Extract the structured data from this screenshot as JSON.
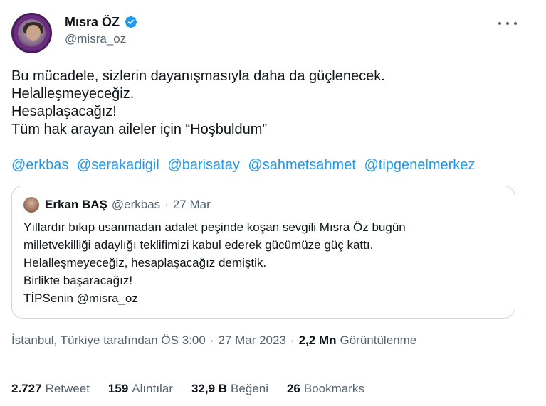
{
  "author": {
    "display_name": "Mısra ÖZ",
    "handle": "@misra_oz",
    "verified": true,
    "verified_color": "#1d9bf0"
  },
  "tweet": {
    "lines": [
      "Bu mücadele, sizlerin dayanışmasıyla daha da güçlenecek.",
      "Helalleşmeyeceğiz.",
      "Hesaplaşacağız!",
      "Tüm hak arayan aileler için “Hoşbuldum”"
    ],
    "mentions": [
      "@erkbas",
      "@serakadigil",
      "@barisatay",
      "@sahmetsahmet",
      "@tipgenelmerkez"
    ]
  },
  "quote": {
    "display_name": "Erkan BAŞ",
    "handle": "@erkbas",
    "separator": "·",
    "date": "27 Mar",
    "lines": [
      "Yıllardır bıkıp usanmadan adalet peşinde koşan sevgili Mısra Öz bugün",
      "milletvekilliği adaylığı teklifimizi kabul ederek gücümüze güç kattı.",
      "Helalleşmeyeceğiz, hesaplaşacağız demiştik.",
      "Birlikte başaracağız!",
      "TİPSenin @misra_oz"
    ]
  },
  "meta": {
    "location_time": "İstanbul, Türkiye tarafından ÖS 3:00",
    "separator": "·",
    "date": "27 Mar 2023",
    "views_count": "2,2 Mn",
    "views_label": "Görüntülenme"
  },
  "stats": {
    "retweets": {
      "count": "2.727",
      "label": "Retweet"
    },
    "quotes": {
      "count": "159",
      "label": "Alıntılar"
    },
    "likes": {
      "count": "32,9 B",
      "label": "Beğeni"
    },
    "bookmarks": {
      "count": "26",
      "label": "Bookmarks"
    }
  },
  "colors": {
    "link": "#1d9bf0",
    "text": "#0f1419",
    "secondary": "#536471",
    "border": "#cfd9de"
  }
}
